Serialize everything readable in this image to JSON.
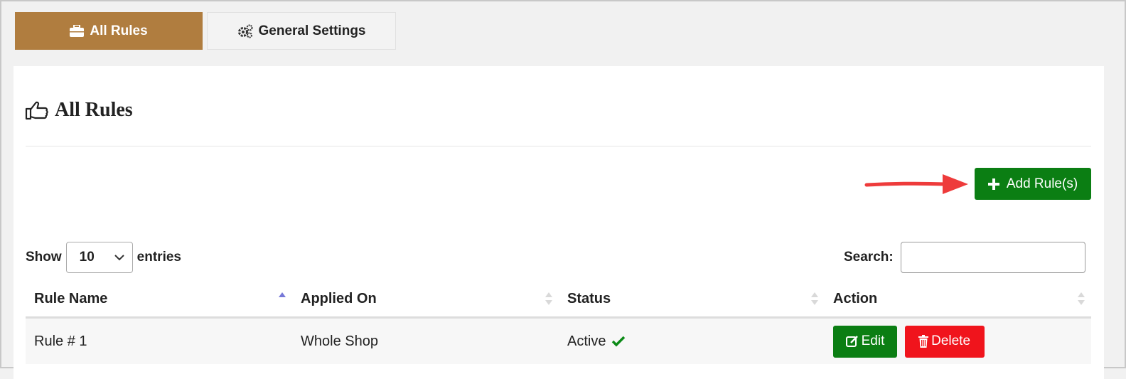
{
  "tabs": [
    {
      "label": "All Rules",
      "icon": "briefcase-icon",
      "active": true
    },
    {
      "label": "General Settings",
      "icon": "gears-icon",
      "active": false
    }
  ],
  "page": {
    "title": "All Rules",
    "title_icon": "thumbs-up-icon"
  },
  "add_button": {
    "label": "Add Rule(s)",
    "icon": "plus-icon"
  },
  "length": {
    "show_label": "Show",
    "entries_label": "entries",
    "selected": "10"
  },
  "search": {
    "label": "Search:",
    "value": ""
  },
  "table": {
    "columns": [
      "Rule Name",
      "Applied On",
      "Status",
      "Action"
    ],
    "rows": [
      {
        "rule_name": "Rule # 1",
        "applied_on": "Whole Shop",
        "status": "Active",
        "edit_label": "Edit",
        "delete_label": "Delete"
      }
    ]
  },
  "colors": {
    "tab_active": "#b07d3f",
    "primary_green": "#0b7e13",
    "danger_red": "#f0141c",
    "arrow_red": "#ee3b3b"
  }
}
